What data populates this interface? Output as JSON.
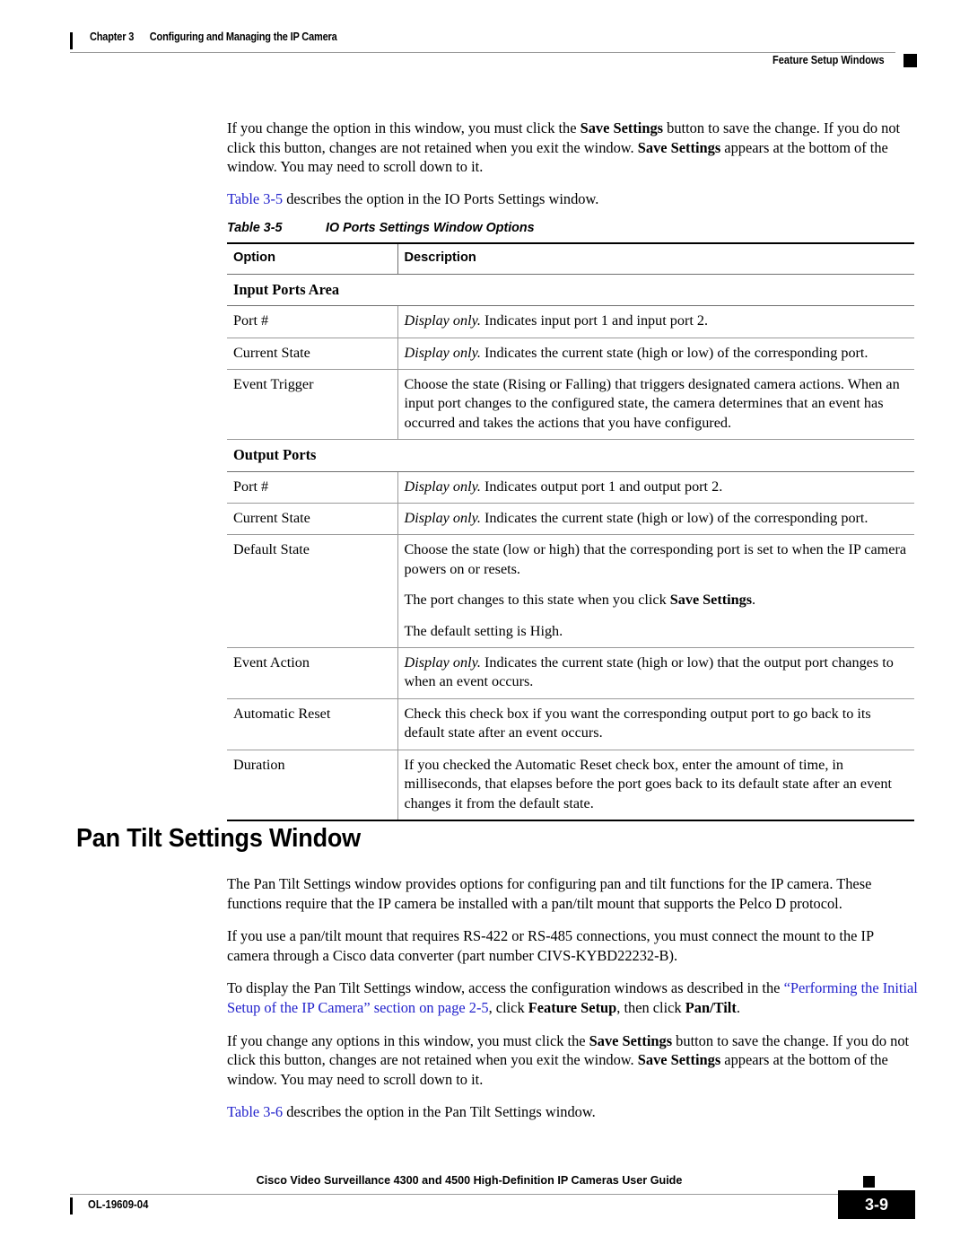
{
  "header": {
    "chapter_number": "Chapter 3",
    "chapter_title": "Configuring and Managing the IP Camera",
    "section_title": "Feature Setup Windows"
  },
  "intro": {
    "para1_part1": "If you change the option in this window, you must click the ",
    "para1_bold1": "Save Settings",
    "para1_part2": " button to save the change. If you do not click this button, changes are not retained when you exit the window. ",
    "para1_bold2": "Save Settings",
    "para1_part3": " appears at the bottom of the window. You may need to scroll down to it.",
    "para2_link": "Table 3-5",
    "para2_rest": " describes the option in the IO Ports Settings window."
  },
  "table": {
    "caption_number": "Table 3-5",
    "caption_title": "IO Ports Settings Window Options",
    "columns": [
      "Option",
      "Description"
    ],
    "rows": [
      {
        "type": "section",
        "label": "Input Ports Area"
      },
      {
        "type": "data",
        "option": "Port #",
        "paragraphs": [
          {
            "italic": "Display only.",
            "text": " Indicates input port 1 and input port 2."
          }
        ]
      },
      {
        "type": "data",
        "option": "Current State",
        "paragraphs": [
          {
            "italic": "Display only.",
            "text": " Indicates the current state (high or low) of the corresponding port."
          }
        ]
      },
      {
        "type": "data",
        "option": "Event Trigger",
        "paragraphs": [
          {
            "italic": "",
            "text": "Choose the state (Rising or Falling) that triggers designated camera actions. When an input port changes to the configured state, the camera determines that an event has occurred and takes the actions that you have configured."
          }
        ]
      },
      {
        "type": "section",
        "label": "Output Ports"
      },
      {
        "type": "data",
        "option": "Port #",
        "paragraphs": [
          {
            "italic": "Display only.",
            "text": " Indicates output port 1 and output port 2."
          }
        ]
      },
      {
        "type": "data",
        "option": "Current State",
        "paragraphs": [
          {
            "italic": "Display only.",
            "text": " Indicates the current state (high or low) of the corresponding port."
          }
        ]
      },
      {
        "type": "data",
        "option": "Default State",
        "paragraphs": [
          {
            "italic": "",
            "text": "Choose the state (low or high) that the corresponding port is set to when the IP camera powers on or resets."
          },
          {
            "italic": "",
            "text": "The port changes to this state when you click ",
            "bold": "Save Settings",
            "after": "."
          },
          {
            "italic": "",
            "text": "The default setting is High."
          }
        ]
      },
      {
        "type": "data",
        "option": "Event Action",
        "paragraphs": [
          {
            "italic": "Display only.",
            "text": " Indicates the current state (high or low) that the output port changes to when an event occurs."
          }
        ]
      },
      {
        "type": "data",
        "option": "Automatic Reset",
        "paragraphs": [
          {
            "italic": "",
            "text": "Check this check box if you want the corresponding output port to go back to its default state after an event occurs."
          }
        ]
      },
      {
        "type": "data",
        "option": "Duration",
        "last": true,
        "paragraphs": [
          {
            "italic": "",
            "text": "If you checked the Automatic Reset check box, enter the amount of time, in milliseconds, that elapses before the port goes back to its default state after an event changes it from the default state."
          }
        ]
      }
    ]
  },
  "section": {
    "heading": "Pan Tilt Settings Window",
    "para1": "The Pan Tilt Settings window provides options for configuring pan and tilt functions for the IP camera. These functions require that the IP camera be installed with a pan/tilt mount that supports the Pelco D protocol.",
    "para2": "If you use a pan/tilt mount that requires RS-422 or RS-485 connections, you must connect the mount to the IP camera through a Cisco data converter (part number CIVS-KYBD22232-B).",
    "para3_part1": "To display the Pan Tilt Settings window, access the configuration windows as described in the ",
    "para3_link": "“Performing the Initial Setup of the IP Camera” section on page 2-5",
    "para3_part2": ", click ",
    "para3_bold1": "Feature Setup",
    "para3_part3": ", then click ",
    "para3_bold2": "Pan/Tilt",
    "para3_part4": ".",
    "para4_part1": "If you change any options in this window, you must click the ",
    "para4_bold1": "Save Settings",
    "para4_part2": " button to save the change. If you do not click this button, changes are not retained when you exit the window. ",
    "para4_bold2": "Save Settings",
    "para4_part3": " appears at the bottom of the window. You may need to scroll down to it.",
    "para5_link": "Table 3-6",
    "para5_rest": " describes the option in the Pan Tilt Settings window."
  },
  "footer": {
    "guide_title": "Cisco Video Surveillance 4300 and 4500 High-Definition IP Cameras User Guide",
    "doc_id": "OL-19609-04",
    "page_number": "3-9"
  },
  "colors": {
    "link": "#2222cc",
    "rule": "#9a9a9a",
    "text": "#000000"
  }
}
